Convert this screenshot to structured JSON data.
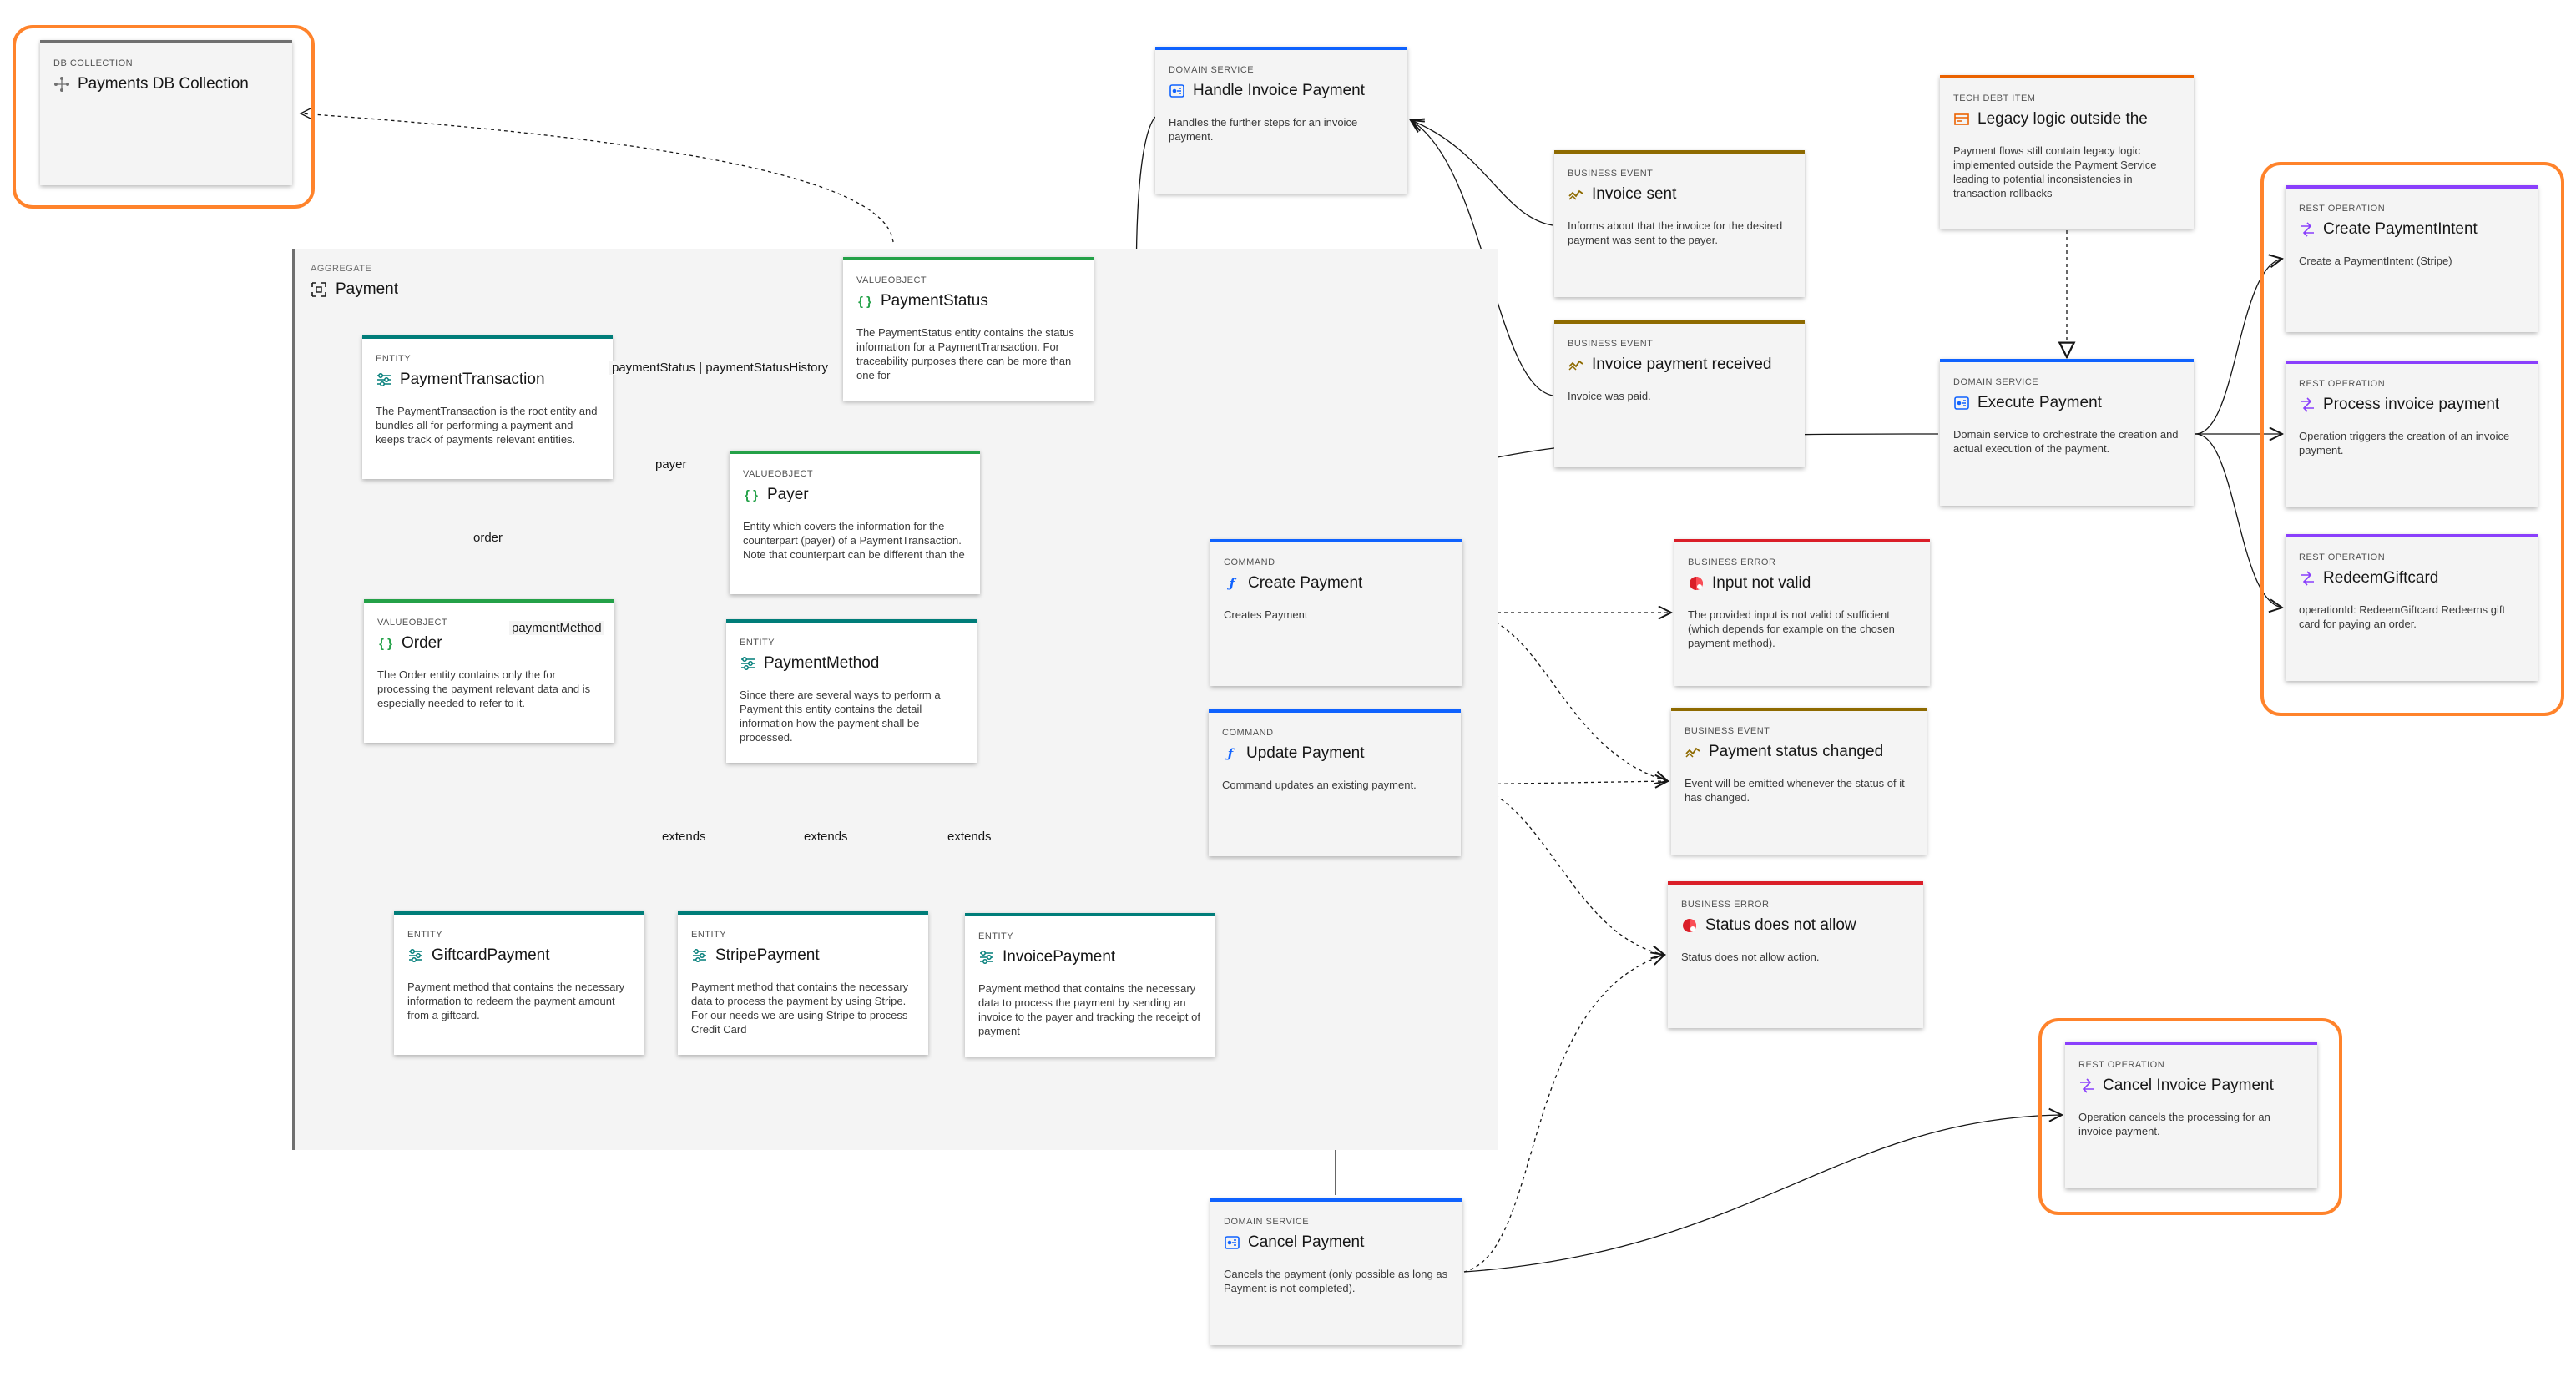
{
  "aggregate": {
    "kind": "AGGREGATE",
    "title": "Payment"
  },
  "nodes": {
    "db_collection": {
      "kind": "DB COLLECTION",
      "title": "Payments DB Collection",
      "desc": ""
    },
    "payment_transaction": {
      "kind": "ENTITY",
      "title": "PaymentTransaction",
      "desc": "The PaymentTransaction is the root entity and bundles all for performing a payment and keeps track of payments relevant entities."
    },
    "payment_status": {
      "kind": "VALUEOBJECT",
      "title": "PaymentStatus",
      "desc": "The PaymentStatus entity contains the status information for a PaymentTransaction. For traceability purposes there can be more than one for"
    },
    "payer": {
      "kind": "VALUEOBJECT",
      "title": "Payer",
      "desc": "Entity which covers the information for the counterpart (payer) of a PaymentTransaction. Note that counterpart can be different than the"
    },
    "order": {
      "kind": "VALUEOBJECT",
      "title": "Order",
      "desc": "The Order entity contains only the for processing the payment relevant data and is especially needed to refer to it."
    },
    "payment_method": {
      "kind": "ENTITY",
      "title": "PaymentMethod",
      "desc": "Since there are several ways to perform a Payment this entity contains the detail information how the payment shall be processed."
    },
    "giftcard_payment": {
      "kind": "ENTITY",
      "title": "GiftcardPayment",
      "desc": "Payment method that contains the necessary information to redeem the payment amount from a giftcard."
    },
    "stripe_payment": {
      "kind": "ENTITY",
      "title": "StripePayment",
      "desc": "Payment method that contains the necessary data to process the payment by using Stripe. For our needs we are using Stripe to process Credit Card"
    },
    "invoice_payment": {
      "kind": "ENTITY",
      "title": "InvoicePayment",
      "desc": "Payment method that contains the necessary data to process the payment by sending an invoice to the payer and tracking the receipt of payment"
    },
    "handle_invoice_payment": {
      "kind": "DOMAIN SERVICE",
      "title": "Handle Invoice Payment",
      "desc": "Handles the further steps for an invoice payment."
    },
    "invoice_sent": {
      "kind": "BUSINESS EVENT",
      "title": "Invoice sent",
      "desc": "Informs about that the invoice for the desired payment was sent to the payer."
    },
    "invoice_payment_received": {
      "kind": "BUSINESS EVENT",
      "title": "Invoice payment received",
      "desc": "Invoice was paid."
    },
    "legacy_logic": {
      "kind": "TECH DEBT ITEM",
      "title": "Legacy logic outside the",
      "desc": "Payment flows still contain legacy logic implemented outside the Payment Service leading to potential inconsistencies in transaction rollbacks"
    },
    "execute_payment": {
      "kind": "DOMAIN SERVICE",
      "title": "Execute Payment",
      "desc": "Domain service to orchestrate the creation and actual execution of the payment."
    },
    "create_payment_intent": {
      "kind": "REST OPERATION",
      "title": "Create PaymentIntent",
      "desc": "Create a PaymentIntent (Stripe)"
    },
    "process_invoice_payment": {
      "kind": "REST OPERATION",
      "title": "Process invoice payment",
      "desc": "Operation triggers the creation of an invoice payment."
    },
    "redeem_giftcard": {
      "kind": "REST OPERATION",
      "title": "RedeemGiftcard",
      "desc": "operationId: RedeemGiftcard Redeems gift card for paying an order."
    },
    "create_payment": {
      "kind": "COMMAND",
      "title": "Create Payment",
      "desc": "Creates Payment"
    },
    "update_payment": {
      "kind": "COMMAND",
      "title": "Update Payment",
      "desc": "Command updates an existing payment."
    },
    "input_not_valid": {
      "kind": "BUSINESS ERROR",
      "title": "Input not valid",
      "desc": "The provided input is not valid of sufficient (which depends for example on the chosen payment method)."
    },
    "payment_status_changed": {
      "kind": "BUSINESS EVENT",
      "title": "Payment status changed",
      "desc": "Event will be emitted whenever the status of it has changed."
    },
    "status_not_allow": {
      "kind": "BUSINESS ERROR",
      "title": "Status does not allow",
      "desc": "Status does not allow action."
    },
    "cancel_invoice_payment": {
      "kind": "REST OPERATION",
      "title": "Cancel Invoice Payment",
      "desc": "Operation cancels the processing for an invoice payment."
    },
    "cancel_payment": {
      "kind": "DOMAIN SERVICE",
      "title": "Cancel Payment",
      "desc": "Cancels the payment (only possible as long as Payment is not completed)."
    }
  },
  "edge_labels": {
    "payment_status": "paymentStatus | paymentStatusHistory",
    "payer": "payer",
    "order": "order",
    "payment_method": "paymentMethod",
    "extends_giftcard": "extends",
    "extends_stripe": "extends",
    "extends_invoice": "extends"
  },
  "colors": {
    "entity": "#007d79",
    "valueobject": "#24a148",
    "domain_service": "#0f62fe",
    "business_event": "#8e6a00",
    "business_error": "#da1e28",
    "rest_operation": "#8a3ffc",
    "tech_debt": "#eb6200",
    "highlight": "#ff832b"
  }
}
